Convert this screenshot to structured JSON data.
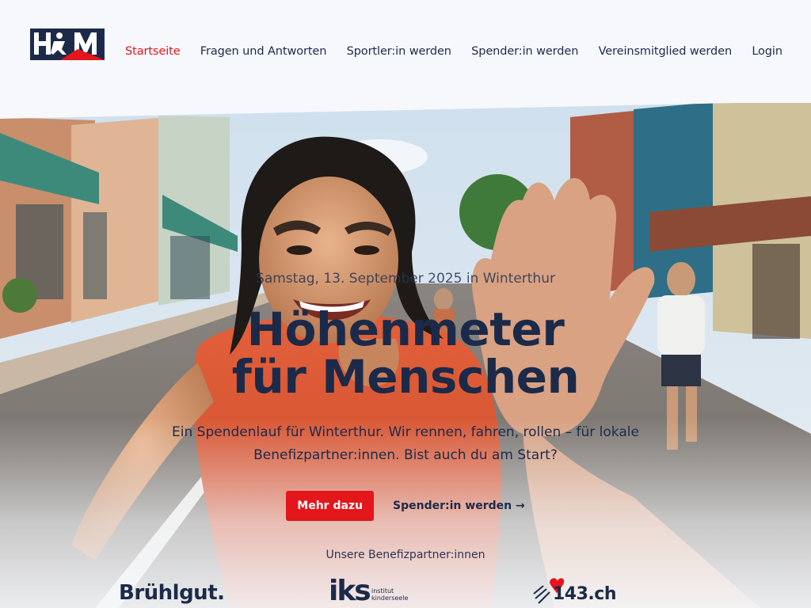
{
  "logo": {
    "text": "H6M",
    "icon": "hoehenmeter-logo"
  },
  "nav": {
    "items": [
      {
        "label": "Startseite",
        "active": true
      },
      {
        "label": "Fragen und Antworten",
        "active": false
      },
      {
        "label": "Sportler:in werden",
        "active": false
      },
      {
        "label": "Spender:in werden",
        "active": false
      },
      {
        "label": "Vereinsmitglied werden",
        "active": false
      },
      {
        "label": "Login",
        "active": false
      }
    ]
  },
  "hero": {
    "dateline": "Samstag, 13. September 2025 in Winterthur",
    "headline_line1": "Höhenmeter",
    "headline_line2": "für Menschen",
    "lead_line1": "Ein Spendenlauf für Winterthur. Wir rennen, fahren, rollen – für lokale",
    "lead_line2": "Benefizpartner:innen. Bist auch du am Start?",
    "primary_cta": "Mehr dazu",
    "secondary_cta": "Spender:in werden →",
    "partners_label": "Unsere Benefizpartner:innen"
  },
  "partners": {
    "p1": "Brühlgut.",
    "p2_mark": "iks",
    "p2_sub_line1": "institut",
    "p2_sub_line2": "kinderseele",
    "p3": "143.ch"
  },
  "colors": {
    "brand_navy": "#1c2a4a",
    "accent_red": "#e3161b",
    "background": "#f6f8fb"
  }
}
